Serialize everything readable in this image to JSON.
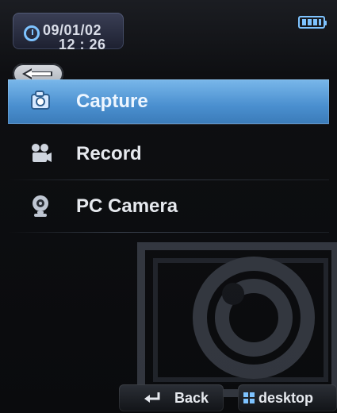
{
  "status": {
    "date": "09/01/02",
    "time": "12 : 26",
    "clock_icon": "clock-icon",
    "battery_icon": "battery-icon",
    "accent": "#7ec3ff"
  },
  "nav": {
    "back_arrow_icon": "back-arrow-icon"
  },
  "menu": {
    "items": [
      {
        "label": "Capture",
        "icon": "camera-icon",
        "selected": true
      },
      {
        "label": "Record",
        "icon": "video-camera-icon",
        "selected": false
      },
      {
        "label": "PC Camera",
        "icon": "webcam-icon",
        "selected": false
      }
    ],
    "selected_color": "#5aa0dd"
  },
  "softkeys": {
    "back_label": "Back",
    "desktop_label": "desktop",
    "back_icon": "return-arrow-icon",
    "desktop_icon": "grid-icon"
  },
  "background": {
    "graphic": "webcam-graphic"
  }
}
